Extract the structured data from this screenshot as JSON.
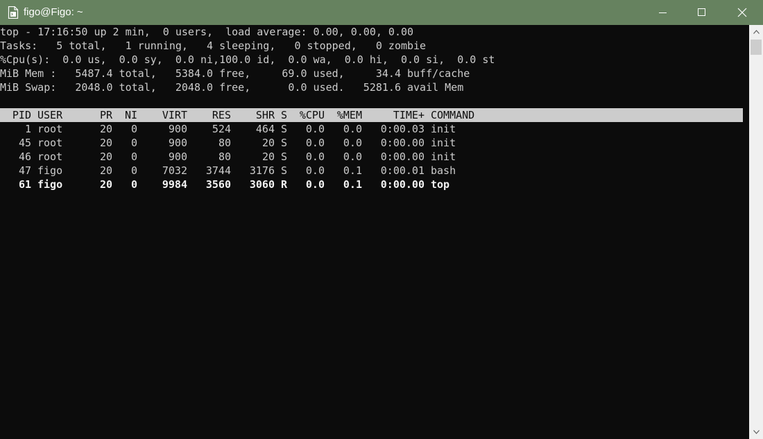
{
  "window": {
    "title": "figo@Figo: ~",
    "icon": "terminal-document-icon",
    "controls": [
      "minimize-icon",
      "maximize-icon",
      "close-icon"
    ],
    "accent_color": "#66825f"
  },
  "terminal": {
    "background": "#0c0c0c",
    "foreground": "#cccccc",
    "summary_lines": [
      "top - 17:16:50 up 2 min,  0 users,  load average: 0.00, 0.00, 0.00",
      "Tasks:   5 total,   1 running,   4 sleeping,   0 stopped,   0 zombie",
      "%Cpu(s):  0.0 us,  0.0 sy,  0.0 ni,100.0 id,  0.0 wa,  0.0 hi,  0.0 si,  0.0 st",
      "MiB Mem :   5487.4 total,   5384.0 free,     69.0 used,     34.4 buff/cache",
      "MiB Swap:   2048.0 total,   2048.0 free,      0.0 used.   5281.6 avail Mem"
    ],
    "columns": [
      "PID",
      "USER",
      "PR",
      "NI",
      "VIRT",
      "RES",
      "SHR",
      "S",
      "%CPU",
      "%MEM",
      "TIME+",
      "COMMAND"
    ],
    "processes": [
      {
        "pid": "1",
        "user": "root",
        "pr": "20",
        "ni": "0",
        "virt": "900",
        "res": "524",
        "shr": "464",
        "s": "S",
        "cpu": "0.0",
        "mem": "0.0",
        "time": "0:00.03",
        "command": "init",
        "highlight": false
      },
      {
        "pid": "45",
        "user": "root",
        "pr": "20",
        "ni": "0",
        "virt": "900",
        "res": "80",
        "shr": "20",
        "s": "S",
        "cpu": "0.0",
        "mem": "0.0",
        "time": "0:00.00",
        "command": "init",
        "highlight": false
      },
      {
        "pid": "46",
        "user": "root",
        "pr": "20",
        "ni": "0",
        "virt": "900",
        "res": "80",
        "shr": "20",
        "s": "S",
        "cpu": "0.0",
        "mem": "0.0",
        "time": "0:00.00",
        "command": "init",
        "highlight": false
      },
      {
        "pid": "47",
        "user": "figo",
        "pr": "20",
        "ni": "0",
        "virt": "7032",
        "res": "3744",
        "shr": "3176",
        "s": "S",
        "cpu": "0.0",
        "mem": "0.1",
        "time": "0:00.01",
        "command": "bash",
        "highlight": false
      },
      {
        "pid": "61",
        "user": "figo",
        "pr": "20",
        "ni": "0",
        "virt": "9984",
        "res": "3560",
        "shr": "3060",
        "s": "R",
        "cpu": "0.0",
        "mem": "0.1",
        "time": "0:00.00",
        "command": "top",
        "highlight": true
      }
    ]
  },
  "scrollbar": {
    "up_icon": "scroll-up-arrow-icon",
    "down_icon": "scroll-down-arrow-icon"
  }
}
